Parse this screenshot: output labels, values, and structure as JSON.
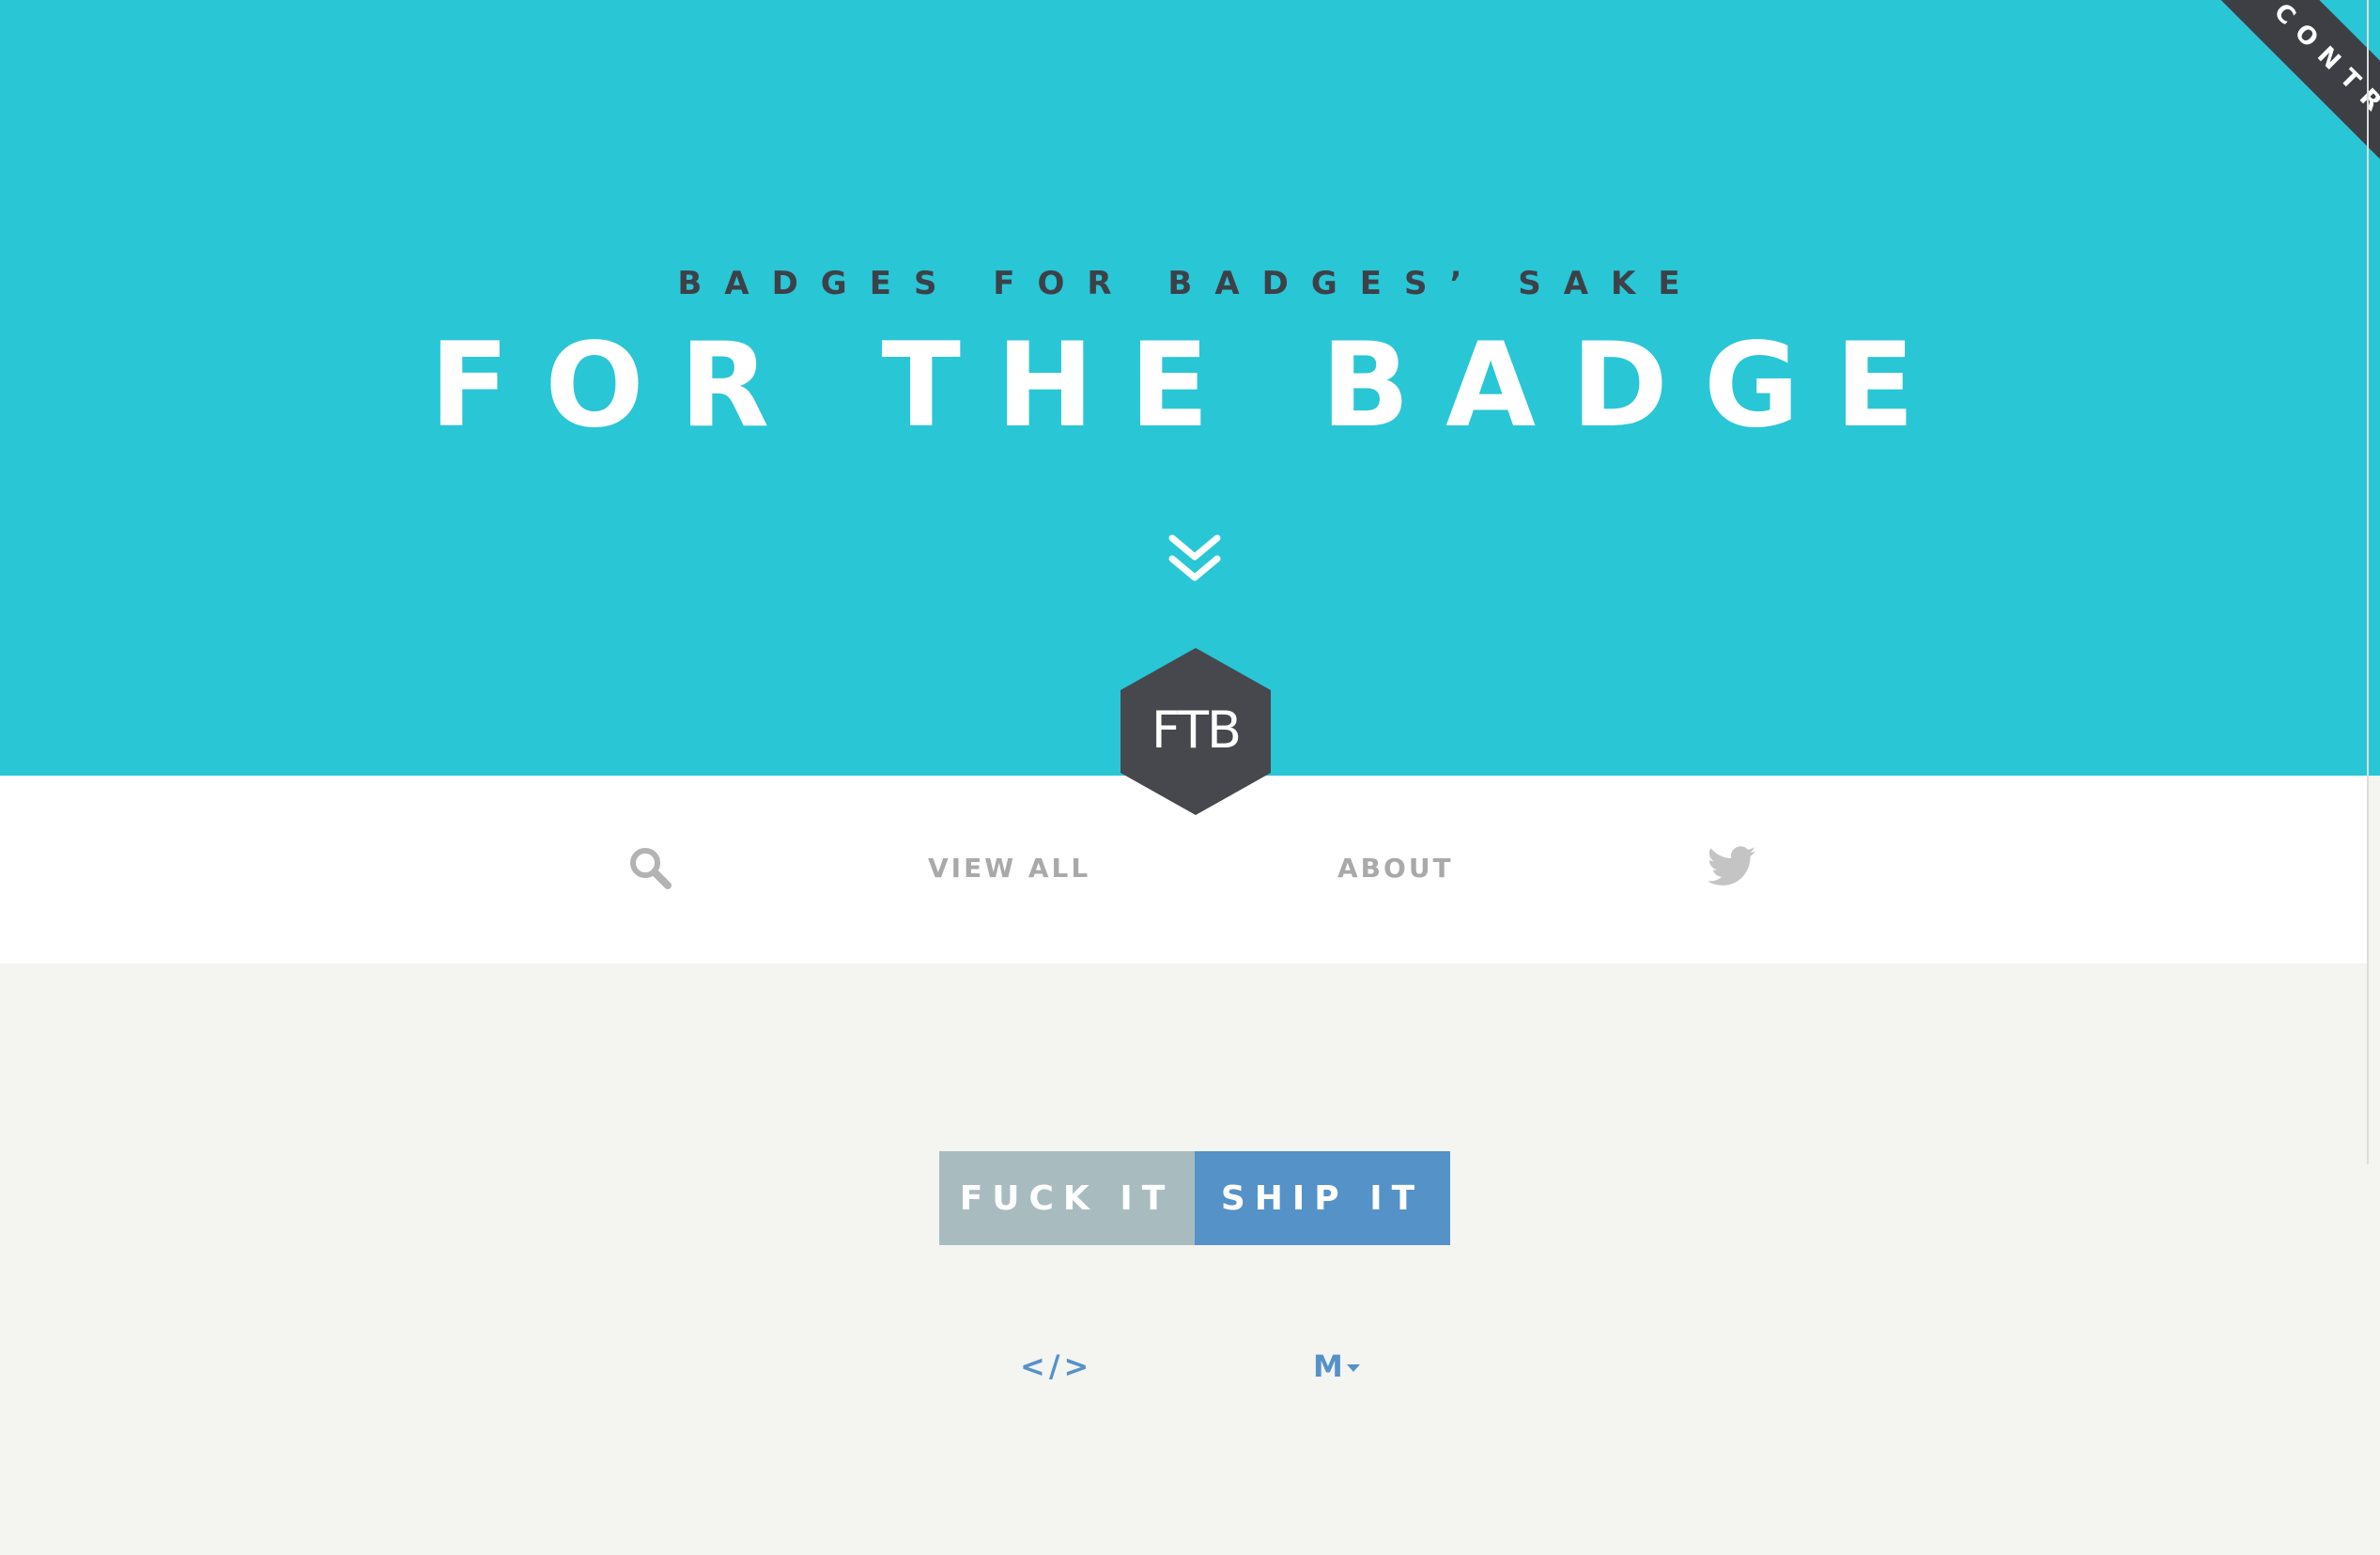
{
  "hero": {
    "tagline": "BADGES FOR BADGES’ SAKE",
    "title": "FOR THE BADGE",
    "background_color": "#29c6d6"
  },
  "ribbon": {
    "label": "CONTRIBUTE",
    "color": "#3d3f45"
  },
  "logo": {
    "text": "FTB",
    "color": "#46484e"
  },
  "nav": {
    "search_icon": "search-icon",
    "view_all": "VIEW ALL",
    "about": "ABOUT",
    "twitter_icon": "twitter-icon"
  },
  "badge": {
    "left_label": "FUCK IT",
    "right_label": "SHIP IT",
    "left_color": "#a8bcbf",
    "right_color": "#5592c8"
  },
  "actions": {
    "code_label": "</>",
    "markdown_label": "M"
  }
}
